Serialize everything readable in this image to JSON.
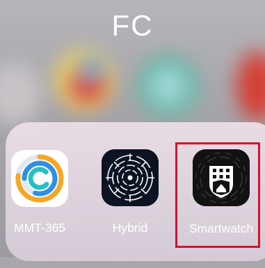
{
  "folder": {
    "title": "FC"
  },
  "apps": [
    {
      "label": "MMT-365",
      "icon": "activity-rings-icon"
    },
    {
      "label": "Hybrid",
      "icon": "circuit-maze-icon"
    },
    {
      "label": "Smartwatch",
      "icon": "building-shield-icon"
    }
  ],
  "highlight": {
    "target": "Smartwatch",
    "color": "#d6112a"
  }
}
